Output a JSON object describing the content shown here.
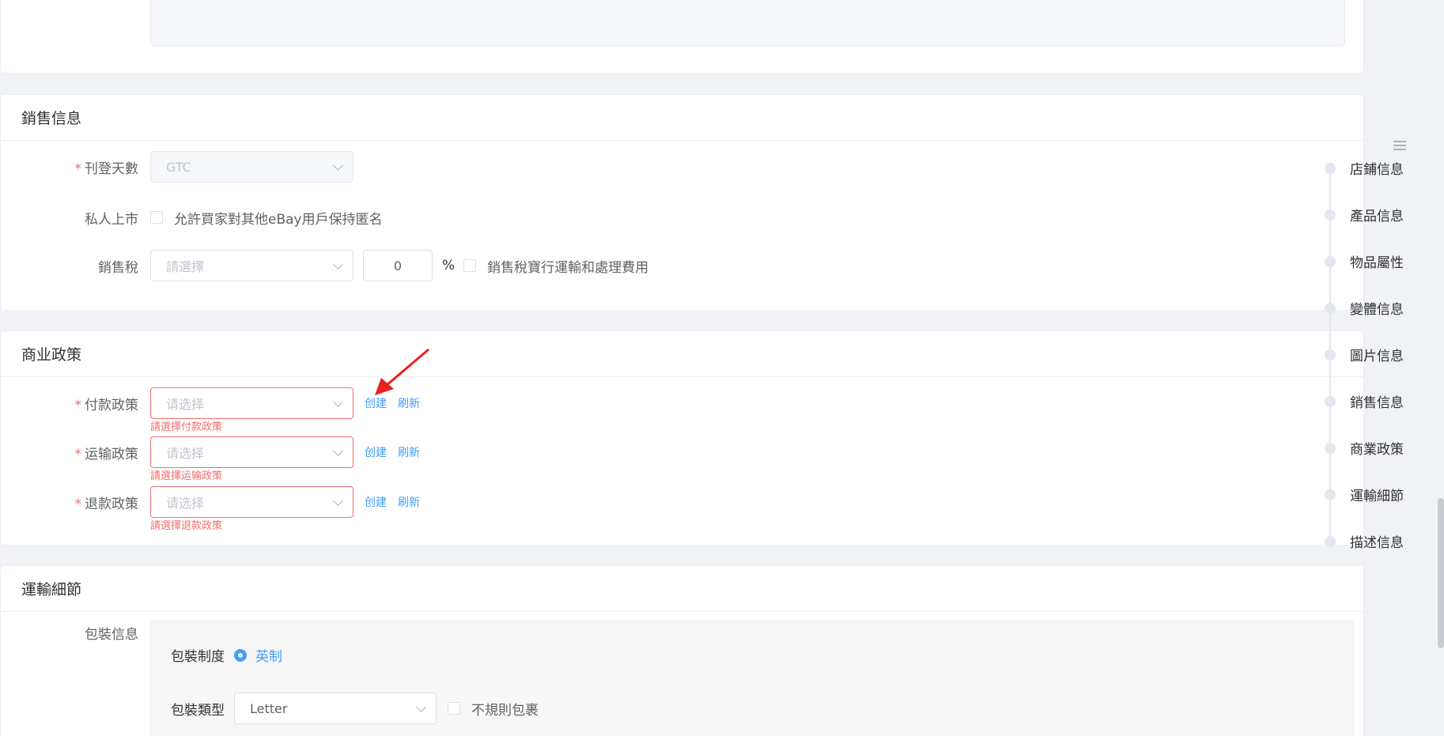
{
  "sales": {
    "title": "銷售信息",
    "listing_days": {
      "label": "刊登天數",
      "value": "GTC"
    },
    "private_listing": {
      "label": "私人上市",
      "checkbox_label": "允許買家對其他eBay用戶保持匿名"
    },
    "sales_tax": {
      "label": "銷售稅",
      "placeholder": "請選擇",
      "percent_value": "0",
      "percent_sign": "%",
      "checkbox_label": "銷售稅寶行運輸和處理費用"
    }
  },
  "policy": {
    "title": "商业政策",
    "create_label": "创建",
    "refresh_label": "刷新",
    "placeholder": "请选择",
    "rows": [
      {
        "label": "付款政策",
        "error": "請選擇付款政策"
      },
      {
        "label": "运输政策",
        "error": "請選擇运输政策"
      },
      {
        "label": "退款政策",
        "error": "請選擇退款政策"
      }
    ]
  },
  "shipping": {
    "title": "運輸細節",
    "package_info_label": "包裝信息",
    "package_system_label": "包裝制度",
    "package_system_value": "英制",
    "package_type_label": "包裝類型",
    "package_type_value": "Letter",
    "irregular_label": "不規則包裹"
  },
  "anchor_nav": {
    "items": [
      "店鋪信息",
      "產品信息",
      "物品屬性",
      "變體信息",
      "圖片信息",
      "銷售信息",
      "商業政策",
      "運輸細節",
      "描述信息"
    ]
  },
  "colors": {
    "accent": "#409eff",
    "error": "#f56c6c",
    "annotation_arrow": "#e8201f"
  }
}
